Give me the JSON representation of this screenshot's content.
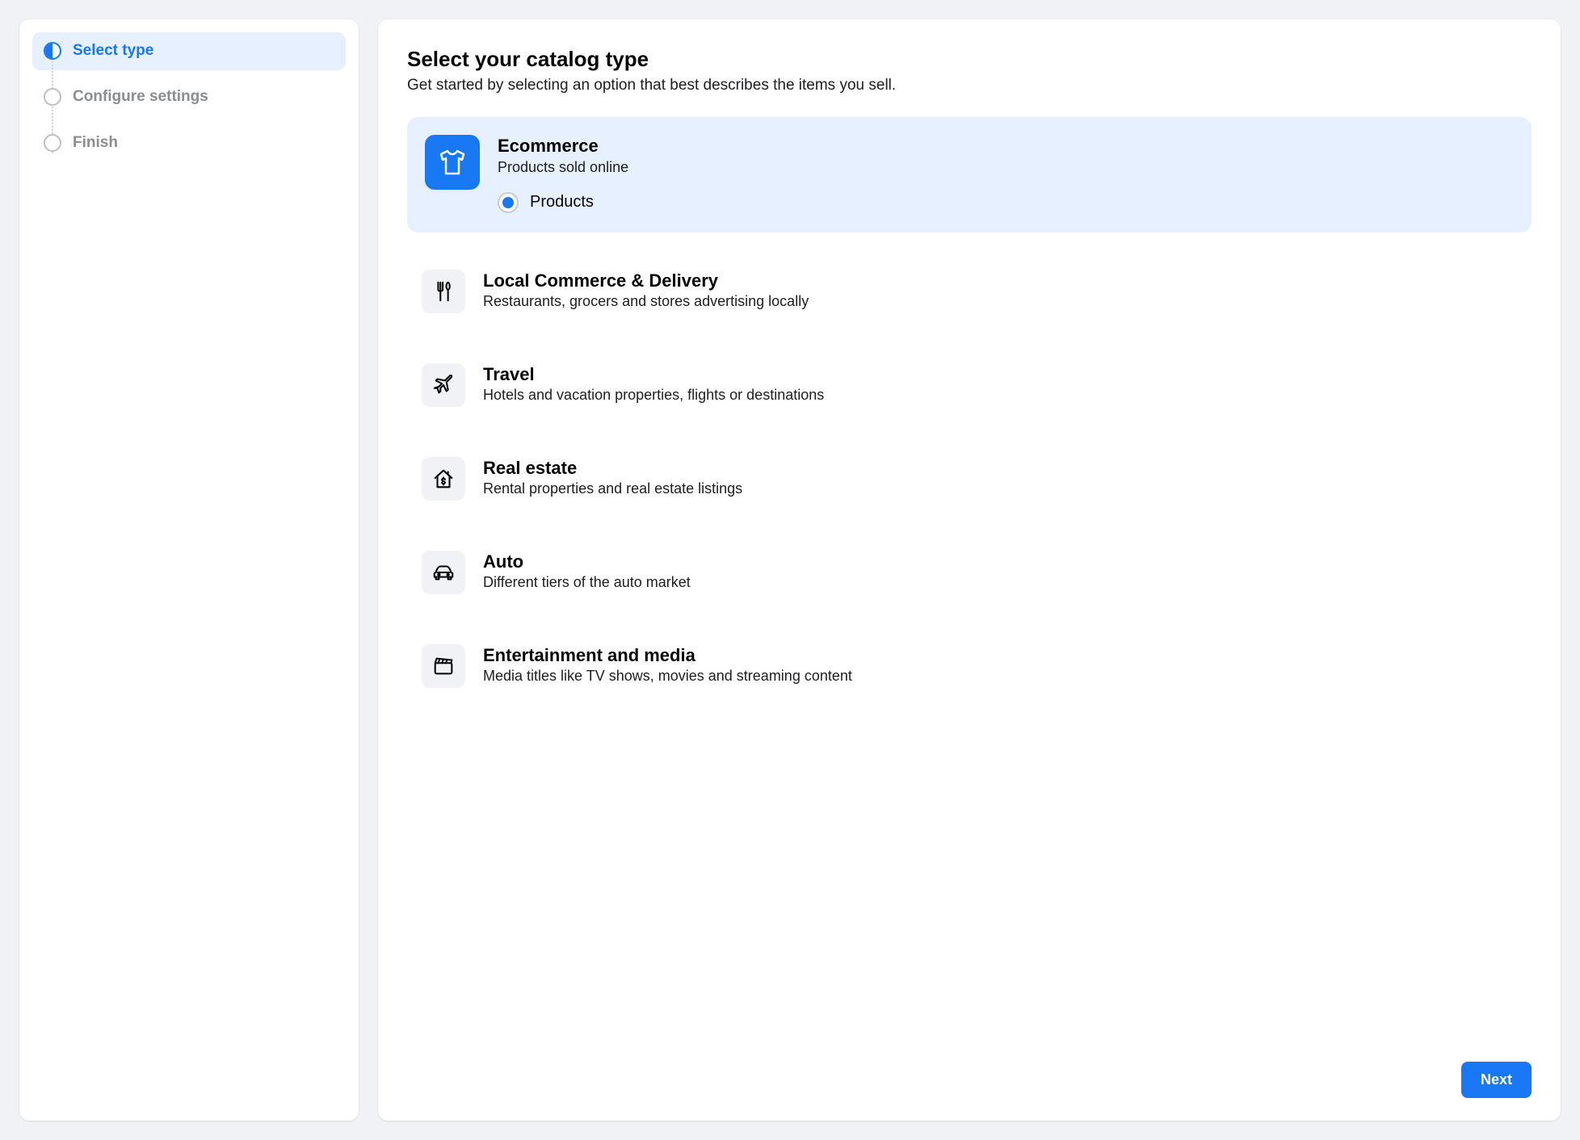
{
  "sidebar": {
    "steps": [
      {
        "label": "Select type"
      },
      {
        "label": "Configure settings"
      },
      {
        "label": "Finish"
      }
    ]
  },
  "main": {
    "title": "Select your catalog type",
    "subtitle": "Get started by selecting an option that best describes the items you sell.",
    "next_label": "Next",
    "options": [
      {
        "title": "Ecommerce",
        "desc": "Products sold online",
        "radio_label": "Products"
      },
      {
        "title": "Local Commerce & Delivery",
        "desc": "Restaurants, grocers and stores advertising locally"
      },
      {
        "title": "Travel",
        "desc": "Hotels and vacation properties, flights or destinations"
      },
      {
        "title": "Real estate",
        "desc": "Rental properties and real estate listings"
      },
      {
        "title": "Auto",
        "desc": "Different tiers of the auto market"
      },
      {
        "title": "Entertainment and media",
        "desc": "Media titles like TV shows, movies and streaming content"
      }
    ]
  }
}
